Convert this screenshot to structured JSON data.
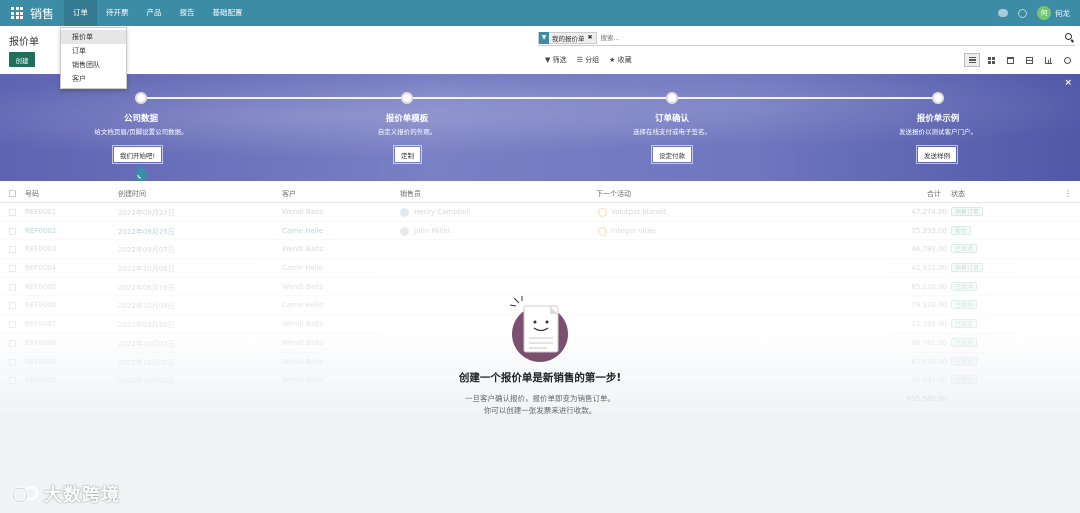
{
  "app": {
    "name": "销售"
  },
  "topnav": {
    "menus": [
      "订单",
      "待开票",
      "产品",
      "报告",
      "基础配置"
    ],
    "user": {
      "initial": "何",
      "name": "何龙"
    }
  },
  "dropdown": {
    "items": [
      "报价单",
      "订单",
      "销售团队",
      "客户"
    ]
  },
  "page": {
    "title": "报价单",
    "create_label": "创建"
  },
  "search": {
    "facet": "我的报价单",
    "facet_icon": "filter-icon",
    "placeholder": "搜索..."
  },
  "search_options": {
    "filter": "▼ 筛选",
    "group": "☰ 分组",
    "favorite": "★ 收藏"
  },
  "banner": {
    "steps": [
      {
        "title": "公司数据",
        "desc": "给文档页眉/页脚设置公司数据。",
        "button": "我们开始吧!"
      },
      {
        "title": "报价单模板",
        "desc": "自定义报价的外观。",
        "button": "定制"
      },
      {
        "title": "订单确认",
        "desc": "选择在线支付或电子签名。",
        "button": "设定付款"
      },
      {
        "title": "报价单示例",
        "desc": "发送报价以测试客户门户。",
        "button": "发送样例"
      }
    ],
    "close": "×"
  },
  "table": {
    "columns": {
      "number": "号码",
      "created": "创建时间",
      "customer": "客户",
      "salesperson": "销售员",
      "activity": "下一个活动",
      "total": "合计",
      "status": "状态"
    },
    "rows": [
      {
        "number": "REF0001",
        "created": "2022年09月23日",
        "customer": "Wendi Baltz",
        "salesperson": "Henry Campbell",
        "activity": "Volutpat blandit",
        "total": "47,274.00",
        "status": "销售订单"
      },
      {
        "number": "REF0002",
        "created": "2022年09月25日",
        "customer": "Carrie Helle",
        "salesperson": "John Miller",
        "activity": "Integer vitae",
        "total": "75,393.00",
        "status": "报价"
      },
      {
        "number": "REF0003",
        "created": "2022年09月07日",
        "customer": "Wendi Baltz",
        "salesperson": "",
        "activity": "",
        "total": "46,783.00",
        "status": "已取消"
      },
      {
        "number": "REF0004",
        "created": "2022年10月06日",
        "customer": "Carrie Helle",
        "salesperson": "",
        "activity": "",
        "total": "41,321.00",
        "status": "销售订单"
      },
      {
        "number": "REF0005",
        "created": "2022年08月19日",
        "customer": "Wendi Baltz",
        "salesperson": "",
        "activity": "",
        "total": "65,120.00",
        "status": "已取消"
      },
      {
        "number": "REF0006",
        "created": "2022年10月09日",
        "customer": "Carrie Helle",
        "salesperson": "",
        "activity": "",
        "total": "79,326.00",
        "status": "已取消"
      },
      {
        "number": "REF0007",
        "created": "2022年09月20日",
        "customer": "Wendi Baltz",
        "salesperson": "",
        "activity": "",
        "total": "11,193.00",
        "status": "已锁定"
      },
      {
        "number": "REF0008",
        "created": "2022年10月03日",
        "customer": "Wendi Baltz",
        "salesperson": "",
        "activity": "",
        "total": "90,761.00",
        "status": "已取消"
      },
      {
        "number": "REF0009",
        "created": "2022年10月05日",
        "customer": "Wendi Baltz",
        "salesperson": "",
        "activity": "",
        "total": "87,976.00",
        "status": "已锁定"
      },
      {
        "number": "REF0010",
        "created": "2022年10月02日",
        "customer": "Wendi Baltz",
        "salesperson": "",
        "activity": "",
        "total": "90,441.00",
        "status": "已锁定"
      }
    ],
    "grand_total": "635,585.00"
  },
  "empty_state": {
    "title": "创建一个报价单是新销售的第一步!",
    "line1": "一旦客户确认报价，报价单即变为销售订单。",
    "line2": "你可以创建一张发票来进行收款。"
  },
  "watermark": {
    "text": "大数跨境"
  },
  "colors": {
    "topbar": "#3c8ca6",
    "create_button": "#1f6f5c",
    "banner": "#6f76be"
  }
}
